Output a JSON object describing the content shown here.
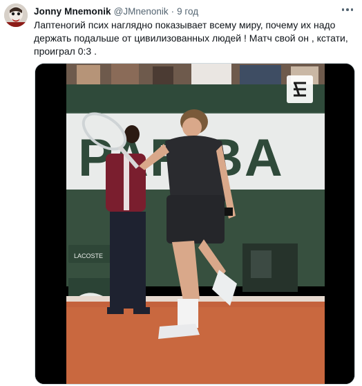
{
  "tweet": {
    "author_name": "Jonny Mnemonik",
    "author_handle": "@JMnenonik",
    "separator": "·",
    "timestamp": "9 год",
    "text": "Лаптеногий псих наглядно показывает всему миру, почему их надо держать подальше от цивилизованных людей ! Матч свой он , кстати, проиграл 0:3 ."
  },
  "media": {
    "banner_text": "PARIBA",
    "sponsor_text": "LACOSTE",
    "watermark_icon": "eurosport-logo-icon"
  },
  "icons": {
    "more": "more-dots-icon",
    "avatar": "avatar-image"
  }
}
